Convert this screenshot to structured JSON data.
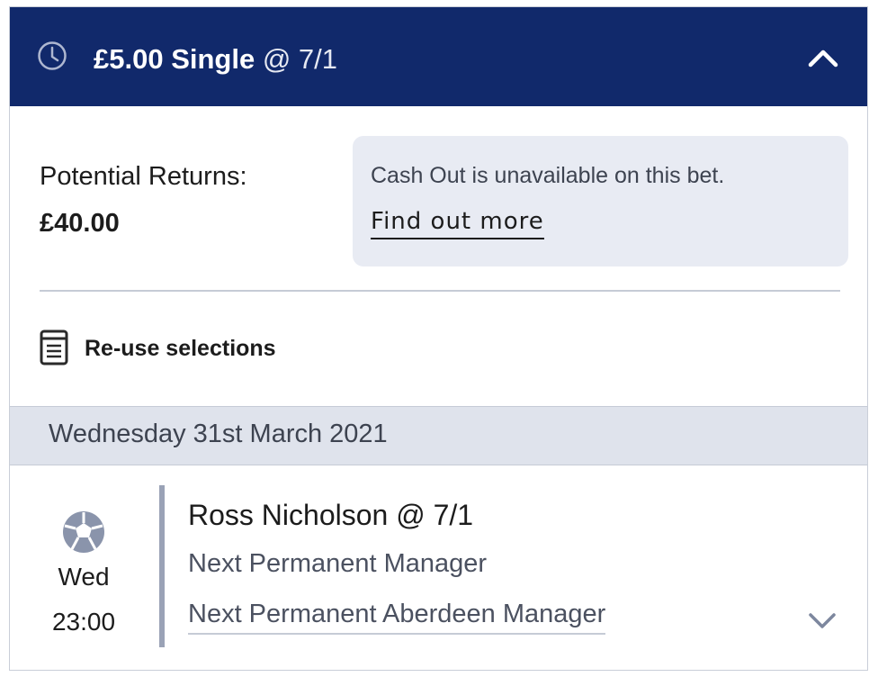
{
  "bet": {
    "stake_type": "£5.00 Single",
    "odds": "@ 7/1",
    "icons": {
      "clock": "clock-icon",
      "collapse": "chevron-up-icon"
    },
    "colors": {
      "header": "#11296b"
    }
  },
  "returns": {
    "label": "Potential Returns:",
    "value": "£40.00"
  },
  "cashout": {
    "message": "Cash Out is unavailable on this bet.",
    "link": "Find out more"
  },
  "reuse": {
    "label": "Re-use selections",
    "icon": "document-list-icon"
  },
  "event_date": "Wednesday 31st March 2021",
  "selection": {
    "sport_icon": "football-icon",
    "day": "Wed",
    "time": "23:00",
    "name": "Ross Nicholson @ 7/1",
    "market": "Next Permanent Manager",
    "event": "Next Permanent Aberdeen Manager",
    "expand_icon": "chevron-down-icon"
  }
}
